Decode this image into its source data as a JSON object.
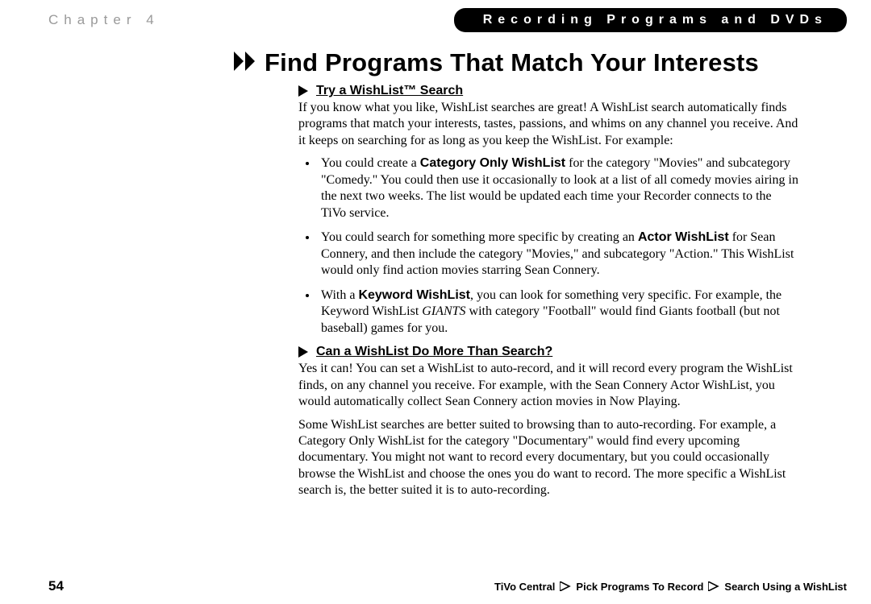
{
  "header": {
    "chapter": "Chapter 4",
    "banner": "Recording Programs and DVDs"
  },
  "title": "Find Programs That Match Your Interests",
  "section1": {
    "heading": "Try a WishList™ Search",
    "intro": "If you know what you like, WishList searches are great! A WishList search automatically finds programs that match your interests, tastes, passions, and whims on any channel you receive. And it keeps on searching for as long as you keep the WishList. For example:",
    "b1_a": "You could create a ",
    "b1_bold": "Category Only WishList",
    "b1_b": " for the category \"Movies\" and subcategory \"Comedy.\" You could then use it occasionally to look at a list of all comedy movies airing in the next two weeks. The list would be updated each time your Recorder connects to the TiVo service.",
    "b2_a": "You could search for something more specific by creating an ",
    "b2_bold": "Actor WishList",
    "b2_b": " for Sean Connery, and then include the category \"Movies,\" and subcategory \"Action.\" This WishList would only find action movies starring Sean Connery.",
    "b3_a": "With a ",
    "b3_bold": "Keyword WishList",
    "b3_b": ", you can look for something very specific. For example, the Keyword WishList ",
    "b3_italic": "GIANTS",
    "b3_c": " with category \"Football\" would find Giants football (but not baseball) games for you."
  },
  "section2": {
    "heading": "Can a WishList Do More Than Search?",
    "para1": "Yes it can! You can set a WishList to auto-record, and it will record every program the WishList finds, on any channel you receive. For example, with the Sean Connery Actor WishList, you would automatically collect Sean Connery action movies in Now Playing.",
    "para2": "Some WishList searches are better suited to browsing than to auto-recording. For example, a Category Only WishList for the category \"Documentary\" would find every upcoming documentary. You might not want to record every documentary, but you could occasionally browse the WishList and choose the ones you do want to record. The more specific a WishList search is, the better suited it is to auto-recording."
  },
  "footer": {
    "page": "54",
    "bc1": "TiVo Central",
    "bc2": "Pick Programs To Record",
    "bc3": "Search Using a WishList"
  }
}
